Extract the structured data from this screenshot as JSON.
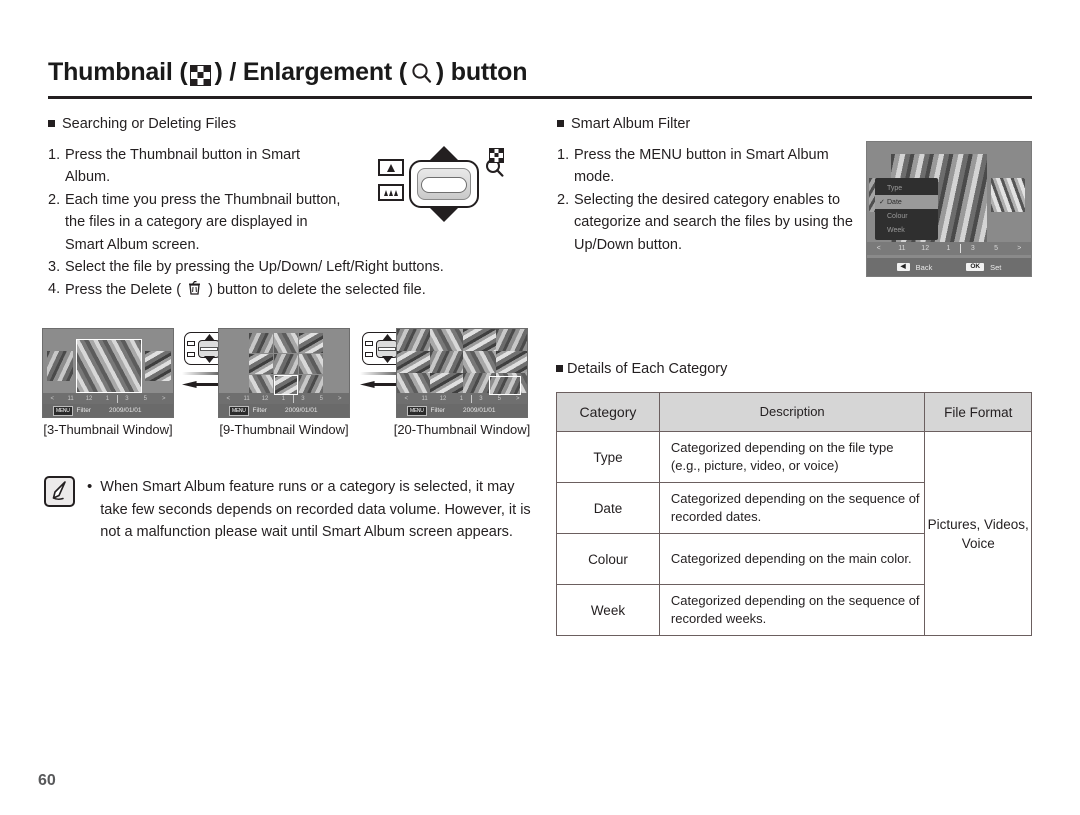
{
  "header": {
    "title_part1": "Thumbnail (",
    "thumbnail_icon": "checker-grid-icon",
    "title_part2": ") / Enlargement (",
    "enlarge_icon": "magnifier-icon",
    "title_part3": ") button"
  },
  "left": {
    "section_title": "Searching or Deleting Files",
    "steps": [
      {
        "num": "1.",
        "text": "Press the Thumbnail button in Smart Album."
      },
      {
        "num": "2.",
        "text": "Each time you press the Thumbnail button, the files in a category are displayed in Smart Album screen."
      },
      {
        "num": "3.",
        "text": "Select the file by pressing the Up/Down/ Left/Right buttons."
      },
      {
        "num": "4a.",
        "text": "Press the Delete ("
      },
      {
        "num": "4b.",
        "text": ") button to delete the selected file."
      }
    ],
    "delete_icon": "trash-can-icon"
  },
  "lever": {
    "name": "zoom-lever-illustration",
    "tele_icon": "tele-zoom-icon",
    "wide_icon": "wide-zoom-icon",
    "magnifier_icon": "magnifier-icon",
    "thumbnail_icon": "checker-grid-icon"
  },
  "thumbnail_windows": [
    {
      "caption": "[3-Thumbnail Window]",
      "count": 3,
      "status_badge": "MENU",
      "status_label": "Filter",
      "status_date": "2009/01/01",
      "filmstrip": [
        "<",
        "11",
        "12",
        "1",
        "3",
        "5",
        ">"
      ]
    },
    {
      "caption": "[9-Thumbnail Window]",
      "count": 9,
      "status_badge": "MENU",
      "status_label": "Filter",
      "status_date": "2009/01/01",
      "filmstrip": [
        "<",
        "11",
        "12",
        "1",
        "3",
        "5",
        ">"
      ]
    },
    {
      "caption": "[20-Thumbnail Window]",
      "count": 20,
      "status_badge": "MENU",
      "status_label": "Filter",
      "status_date": "2009/01/01",
      "filmstrip": [
        "<",
        "11",
        "12",
        "1",
        "3",
        "5",
        ">"
      ]
    }
  ],
  "note": {
    "icon": "note-pencil-icon",
    "bullet": "•",
    "text": "When Smart Album feature runs or a category is selected, it may take few seconds depends on recorded data volume. However, it is not a malfunction please wait until Smart Album screen appears."
  },
  "right": {
    "section_title": "Smart Album Filter",
    "steps": [
      {
        "num": "1.",
        "text": "Press the MENU button in Smart Album mode."
      },
      {
        "num": "2.",
        "text": "Selecting the desired category enables to categorize and search the files by using the Up/Down button."
      }
    ]
  },
  "camera_screen": {
    "name": "smart-album-filter-screen",
    "menu_items": [
      {
        "label": "Type",
        "selected": false
      },
      {
        "label": "Date",
        "selected": true
      },
      {
        "label": "Colour",
        "selected": false
      },
      {
        "label": "Week",
        "selected": false
      }
    ],
    "check_glyph": "✓",
    "filmstrip": [
      "<",
      "11",
      "12",
      "1",
      "3",
      "5",
      ">"
    ],
    "back_button": "Back",
    "back_glyph": "◀",
    "set_button": "Set",
    "set_glyph": "OK"
  },
  "table": {
    "title": "Details of Each Category",
    "columns": [
      "Category",
      "Description",
      "File Format"
    ],
    "rows": [
      {
        "category": "Type",
        "description": "Categorized depending on the file type (e.g., picture, video, or voice)"
      },
      {
        "category": "Date",
        "description": "Categorized depending on the sequence of recorded dates."
      },
      {
        "category": "Colour",
        "description": "Categorized depending on the main color."
      },
      {
        "category": "Week",
        "description": "Categorized depending on the sequence of recorded weeks."
      }
    ],
    "file_format": "Pictures, Videos, Voice"
  },
  "page_number": "60",
  "colors": {
    "text": "#231f20",
    "table_header_bg": "#d6d6d6",
    "table_border": "#6b5f5f",
    "lcd_bg": "#8c8c8c",
    "page_number": "#58595b"
  }
}
